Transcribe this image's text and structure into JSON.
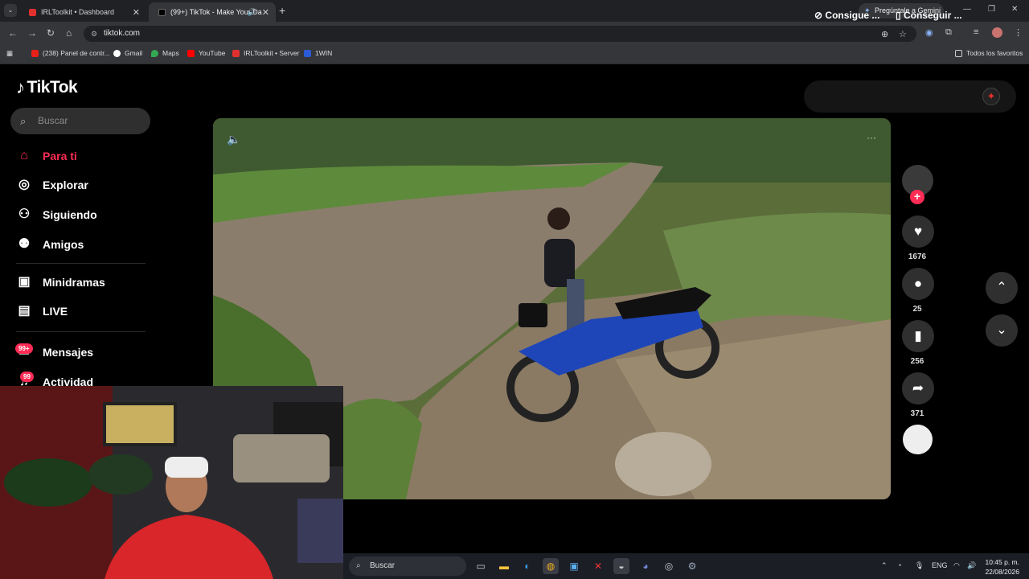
{
  "browser": {
    "tabs": [
      {
        "title": "IRLToolkit • Dashboard"
      },
      {
        "title": "(99+) TikTok - Make Your Da"
      }
    ],
    "gemini_button": "Pregúntale a Gemini",
    "url": "tiktok.com",
    "bookmarks": [
      {
        "label": "(238) Panel de contr...",
        "color": "#e62117"
      },
      {
        "label": "Gmail",
        "color": "#ffffff"
      },
      {
        "label": "Maps",
        "color": "#34a853"
      },
      {
        "label": "YouTube",
        "color": "#ff0000"
      },
      {
        "label": "IRLToolkit • Server",
        "color": "#e0312f"
      },
      {
        "label": "1WIN",
        "color": "#2b5bd7"
      }
    ],
    "all_favorites": "Todos los favoritos"
  },
  "tiktok": {
    "logo": "TikTok",
    "search_placeholder": "Buscar",
    "nav": [
      {
        "label": "Para ti",
        "icon": "home-icon"
      },
      {
        "label": "Explorar",
        "icon": "compass-icon"
      },
      {
        "label": "Siguiendo",
        "icon": "user-follow-icon"
      },
      {
        "label": "Amigos",
        "icon": "friends-icon"
      },
      {
        "label": "Minidramas",
        "icon": "film-icon"
      },
      {
        "label": "LIVE",
        "icon": "tv-icon"
      },
      {
        "label": "Mensajes",
        "icon": "message-icon",
        "badge": "99+"
      },
      {
        "label": "Actividad",
        "icon": "bell-icon",
        "badge": "99"
      }
    ],
    "top_buttons": [
      "Consigue ...",
      "Conseguir ..."
    ],
    "actions": {
      "likes": "1676",
      "comments": "25",
      "saves": "256",
      "shares": "371"
    },
    "accent": "#fe2c55"
  },
  "taskbar": {
    "search_placeholder": "Buscar",
    "language": "ENG",
    "time": "10:45 p. m.",
    "date": "22/08/2026"
  }
}
